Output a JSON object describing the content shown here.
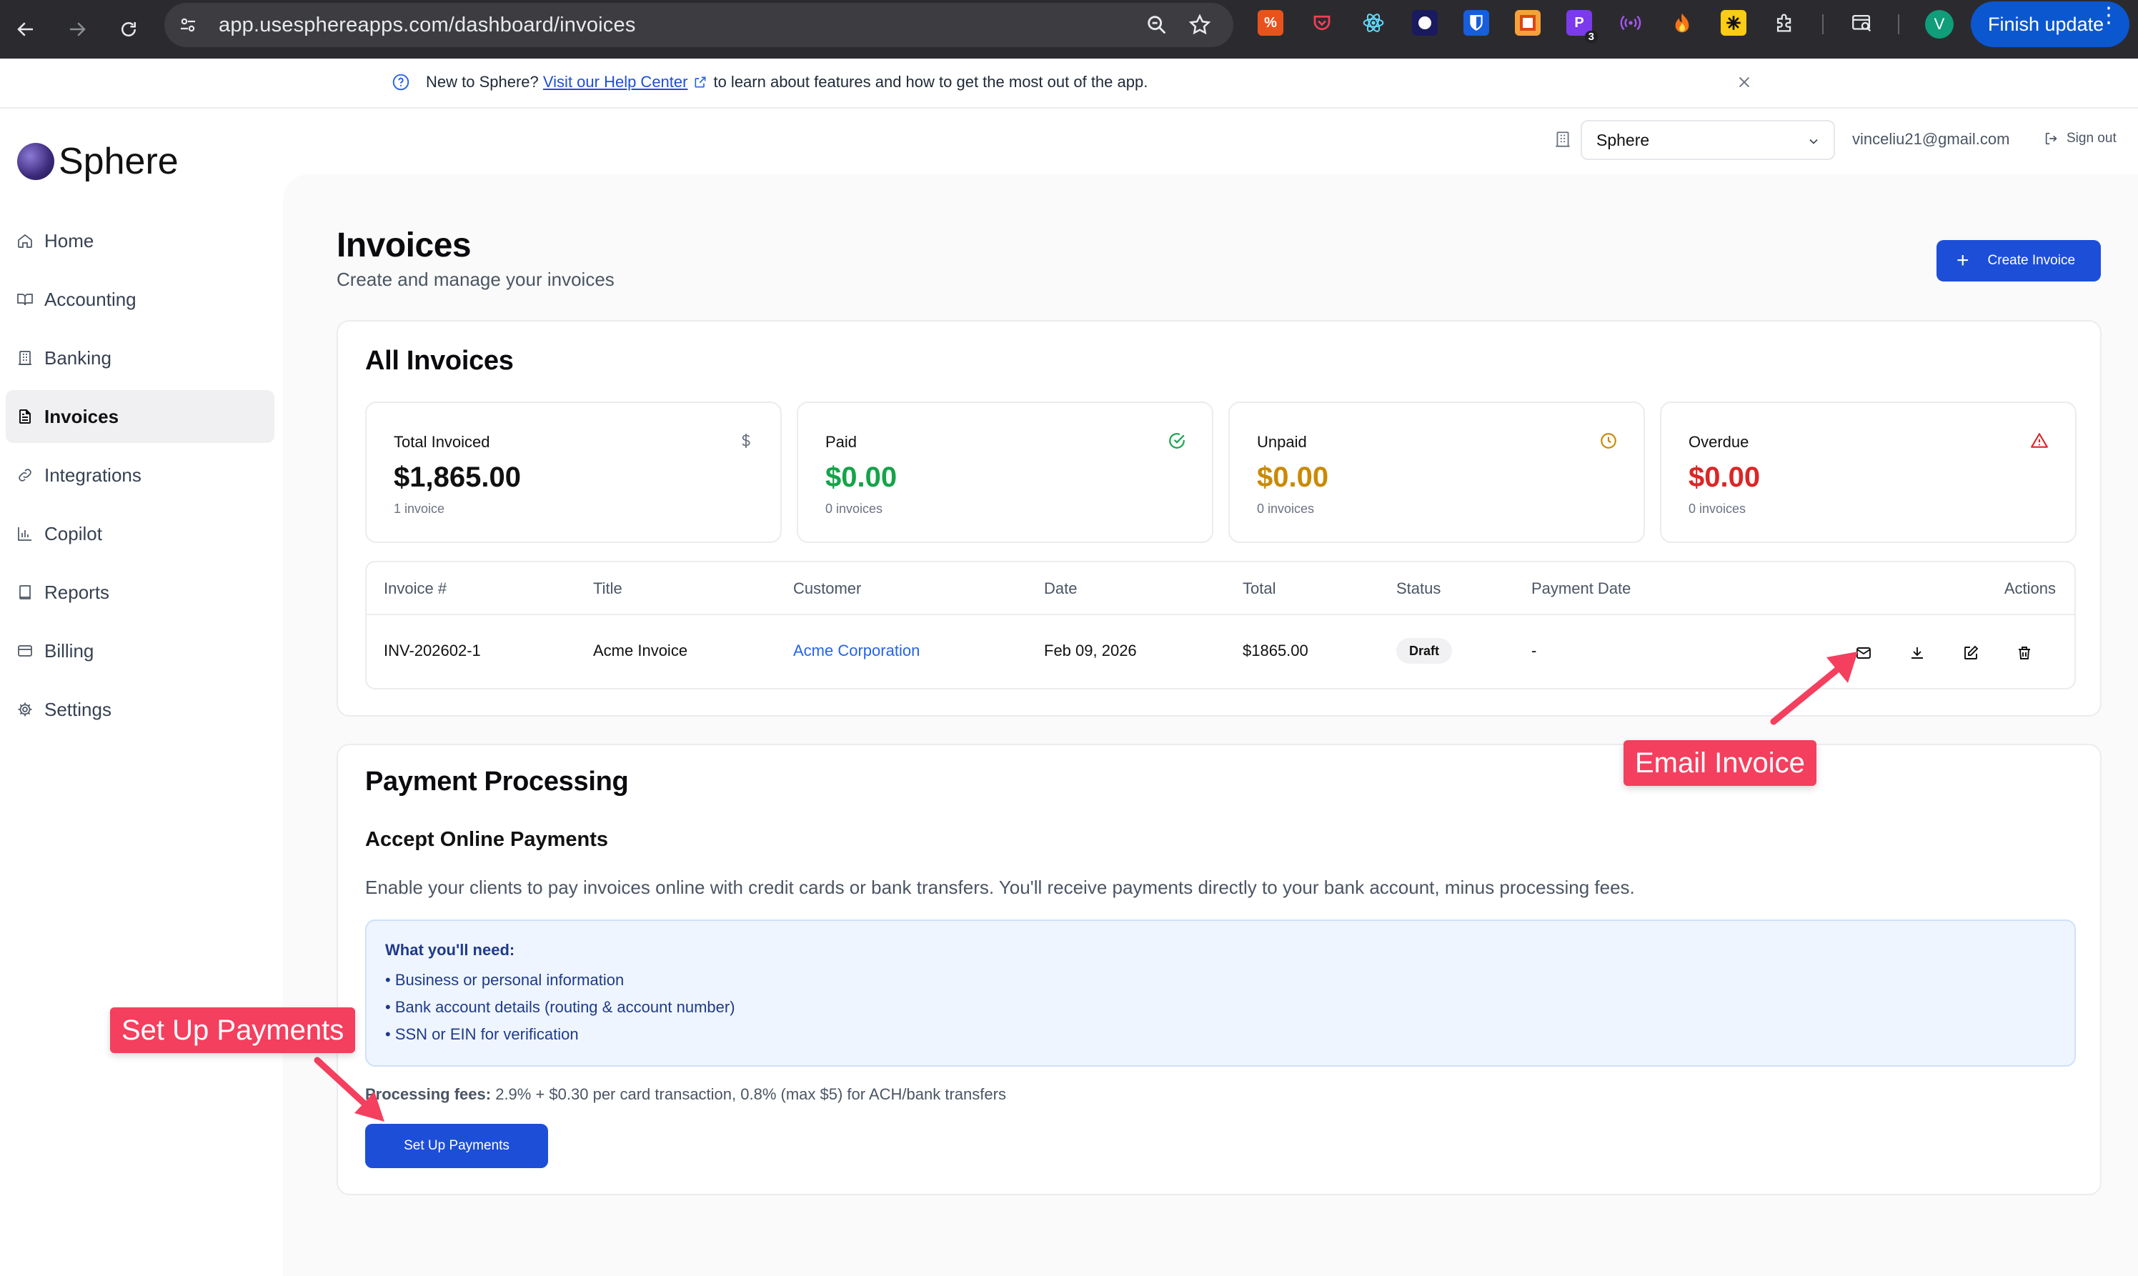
{
  "browser": {
    "url": "app.usesphereapps.com/dashboard/invoices",
    "finish_update": "Finish update",
    "profile_initial": "V",
    "ext_badge_count": "3"
  },
  "banner": {
    "prefix": "New to Sphere?",
    "link": "Visit our Help Center",
    "suffix": "to learn about features and how to get the most out of the app."
  },
  "app": {
    "name": "Sphere"
  },
  "sidebar": {
    "items": [
      {
        "label": "Home",
        "icon": "home-icon"
      },
      {
        "label": "Accounting",
        "icon": "book-icon"
      },
      {
        "label": "Banking",
        "icon": "bank-icon"
      },
      {
        "label": "Invoices",
        "icon": "file-icon",
        "active": true
      },
      {
        "label": "Integrations",
        "icon": "link-icon"
      },
      {
        "label": "Copilot",
        "icon": "chart-icon"
      },
      {
        "label": "Reports",
        "icon": "book-closed-icon"
      },
      {
        "label": "Billing",
        "icon": "credit-card-icon"
      },
      {
        "label": "Settings",
        "icon": "gear-icon"
      }
    ]
  },
  "header": {
    "org_select": "Sphere",
    "email": "vinceliu21@gmail.com",
    "sign_out": "Sign out"
  },
  "page": {
    "title": "Invoices",
    "subtitle": "Create and manage your invoices",
    "create_button": "Create Invoice"
  },
  "all_invoices": {
    "title": "All Invoices",
    "stats": [
      {
        "label": "Total Invoiced",
        "value": "$1,865.00",
        "sub": "1 invoice",
        "color": "#111111",
        "icon": "dollar-icon"
      },
      {
        "label": "Paid",
        "value": "$0.00",
        "sub": "0 invoices",
        "color": "#16a34a",
        "icon": "check-circle-icon"
      },
      {
        "label": "Unpaid",
        "value": "$0.00",
        "sub": "0 invoices",
        "color": "#ca8a04",
        "icon": "clock-icon"
      },
      {
        "label": "Overdue",
        "value": "$0.00",
        "sub": "0 invoices",
        "color": "#dc2626",
        "icon": "alert-triangle-icon"
      }
    ],
    "columns": [
      "Invoice #",
      "Title",
      "Customer",
      "Date",
      "Total",
      "Status",
      "Payment Date",
      "Actions"
    ],
    "rows": [
      {
        "invoice": "INV-202602-1",
        "title": "Acme Invoice",
        "customer": "Acme Corporation",
        "date": "Feb 09, 2026",
        "total": "$1865.00",
        "status": "Draft",
        "payment_date": "-"
      }
    ]
  },
  "payment": {
    "title": "Payment Processing",
    "subtitle": "Accept Online Payments",
    "description": "Enable your clients to pay invoices online with credit cards or bank transfers. You'll receive payments directly to your bank account, minus processing fees.",
    "needs_title": "What you'll need:",
    "needs": [
      "• Business or personal information",
      "• Bank account details (routing & account number)",
      "• SSN or EIN for verification"
    ],
    "fees_label": "Processing fees:",
    "fees_text": "2.9% + $0.30 per card transaction, 0.8% (max $5) for ACH/bank transfers",
    "setup_button": "Set Up Payments"
  },
  "annotations": {
    "email_invoice": "Email Invoice",
    "set_up_payments": "Set Up Payments"
  },
  "colors": {
    "accent": "#1d4ed8",
    "callout": "#f43f5e"
  }
}
